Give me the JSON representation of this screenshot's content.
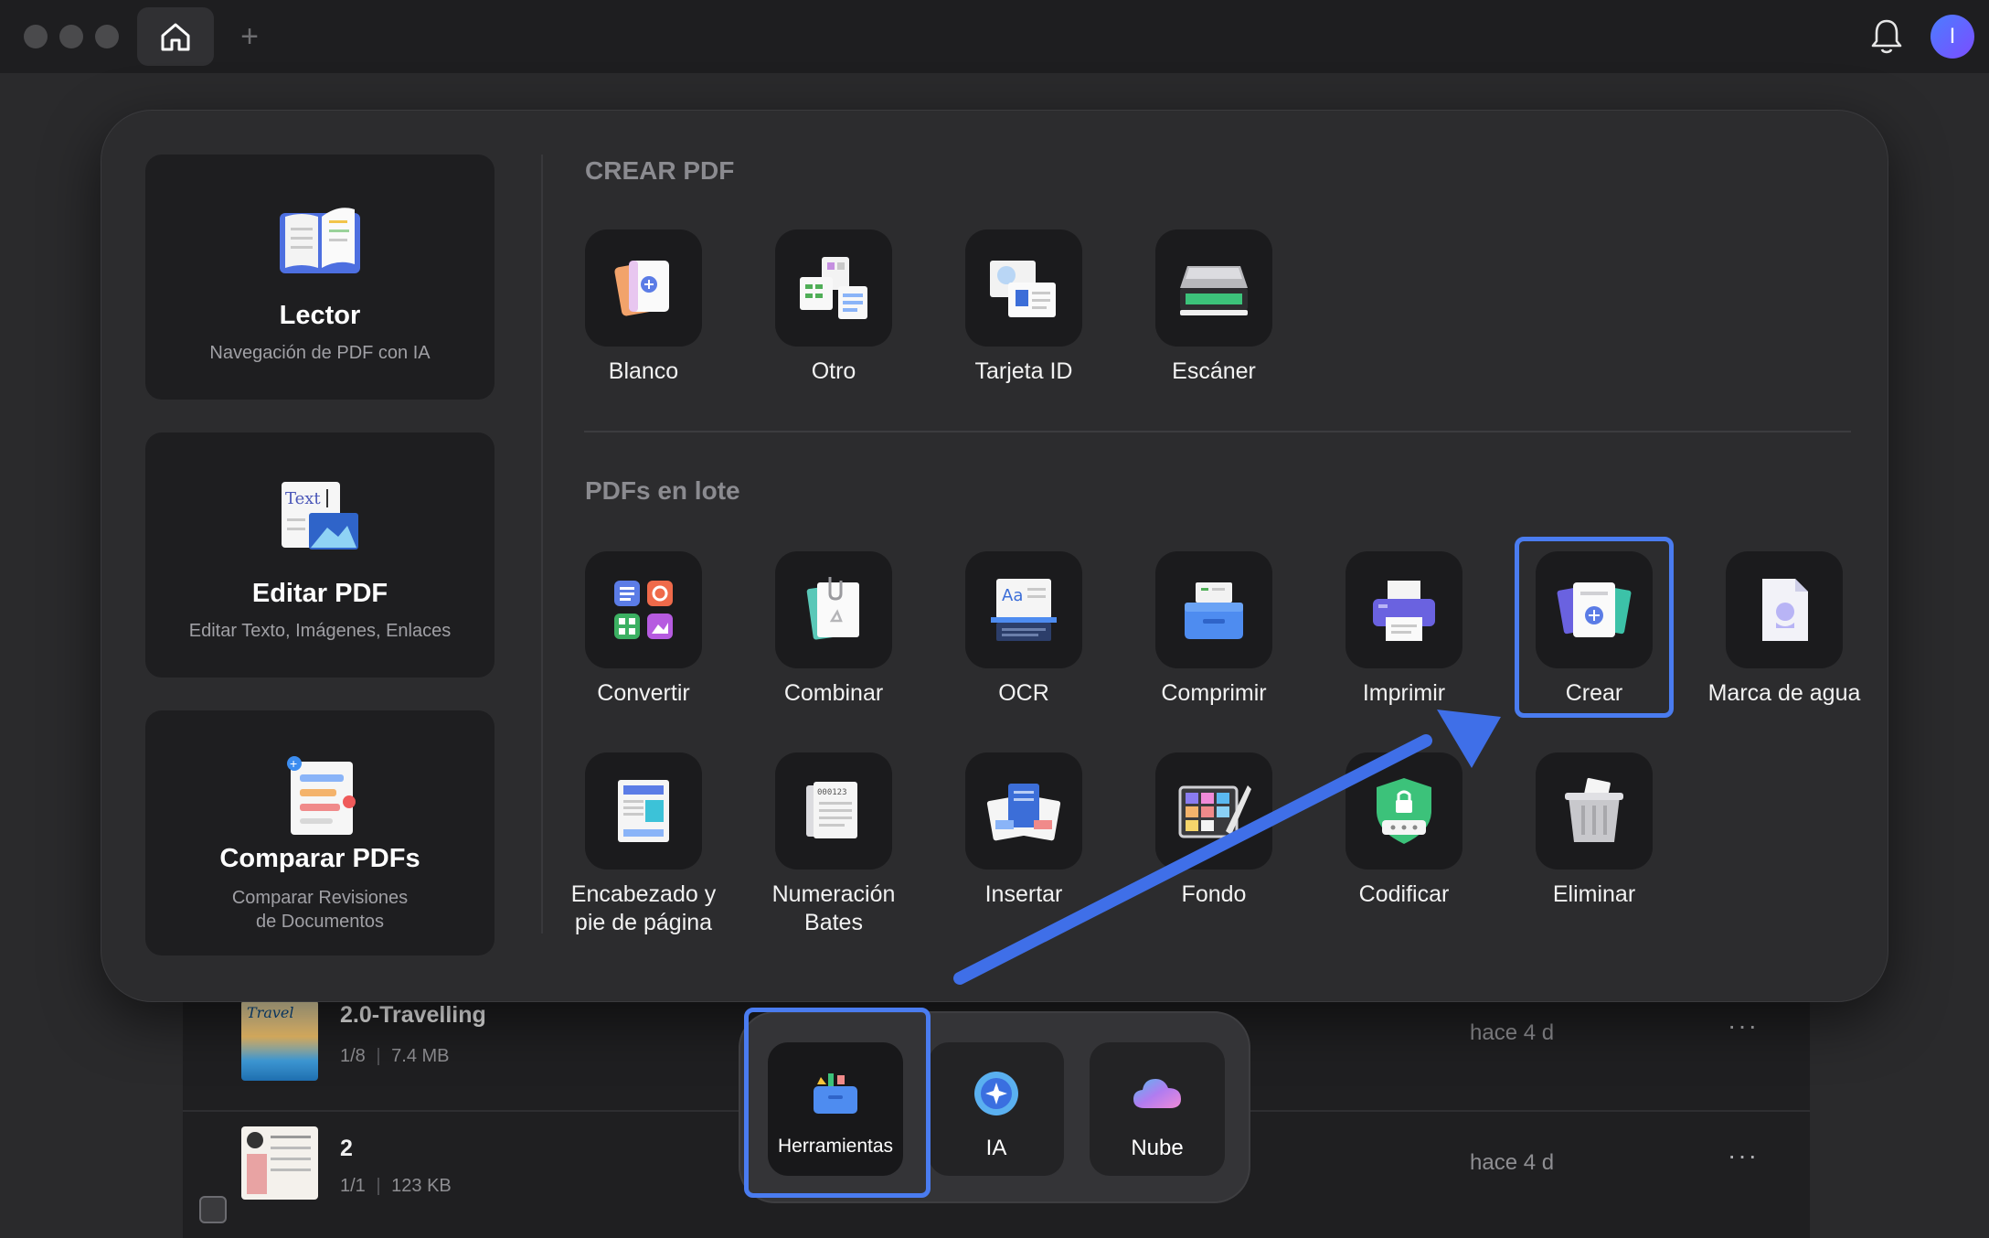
{
  "window": {
    "controls": [
      "close",
      "minimize",
      "zoom"
    ],
    "avatar_initial": "I",
    "add_tab_symbol": "+"
  },
  "feature_cards": [
    {
      "id": "lector",
      "title": "Lector",
      "description": "Navegación de PDF con IA"
    },
    {
      "id": "editar",
      "title": "Editar PDF",
      "description": "Editar Texto, Imágenes, Enlaces"
    },
    {
      "id": "comparar",
      "title": "Comparar PDFs",
      "description_lines": [
        "Comparar Revisiones",
        "de Documentos"
      ]
    }
  ],
  "create_pdf": {
    "title": "CREAR PDF",
    "tools": [
      "Blanco",
      "Otro",
      "Tarjeta ID",
      "Escáner"
    ]
  },
  "batch_pdf": {
    "title": "PDFs en lote",
    "row1": [
      "Convertir",
      "Combinar",
      "OCR",
      "Comprimir",
      "Imprimir",
      "Crear",
      "Marca de agua"
    ],
    "row2": [
      {
        "label_lines": [
          "Encabezado y",
          "pie de página"
        ]
      },
      {
        "label_lines": [
          "Numeración",
          "Bates"
        ]
      },
      {
        "label_lines": [
          "Insertar"
        ]
      },
      {
        "label_lines": [
          "Fondo"
        ]
      },
      {
        "label_lines": [
          "Codificar"
        ]
      },
      {
        "label_lines": [
          "Eliminar"
        ]
      }
    ],
    "highlighted_tool": "Crear"
  },
  "icon_texts": {
    "edit_text": "Text",
    "bates_number": "000123",
    "ocr": "Aa"
  },
  "files": [
    {
      "name": "2.0-Travelling",
      "pages": "1/8",
      "size": "7.4 MB",
      "modified": "hace 4 d",
      "more": "···",
      "thumb_text": "Travel"
    },
    {
      "name": "2",
      "pages": "1/1",
      "size": "123 KB",
      "modified": "hace 4 d",
      "more": "···"
    }
  ],
  "dock": [
    {
      "label": "Herramientas",
      "active": true
    },
    {
      "label": "IA",
      "active": false
    },
    {
      "label": "Nube",
      "active": false
    }
  ],
  "colors": {
    "highlight": "#4a7cf0",
    "arrow": "#3f6fe8",
    "panel": "#2c2c2e",
    "tile": "#1b1b1d"
  }
}
